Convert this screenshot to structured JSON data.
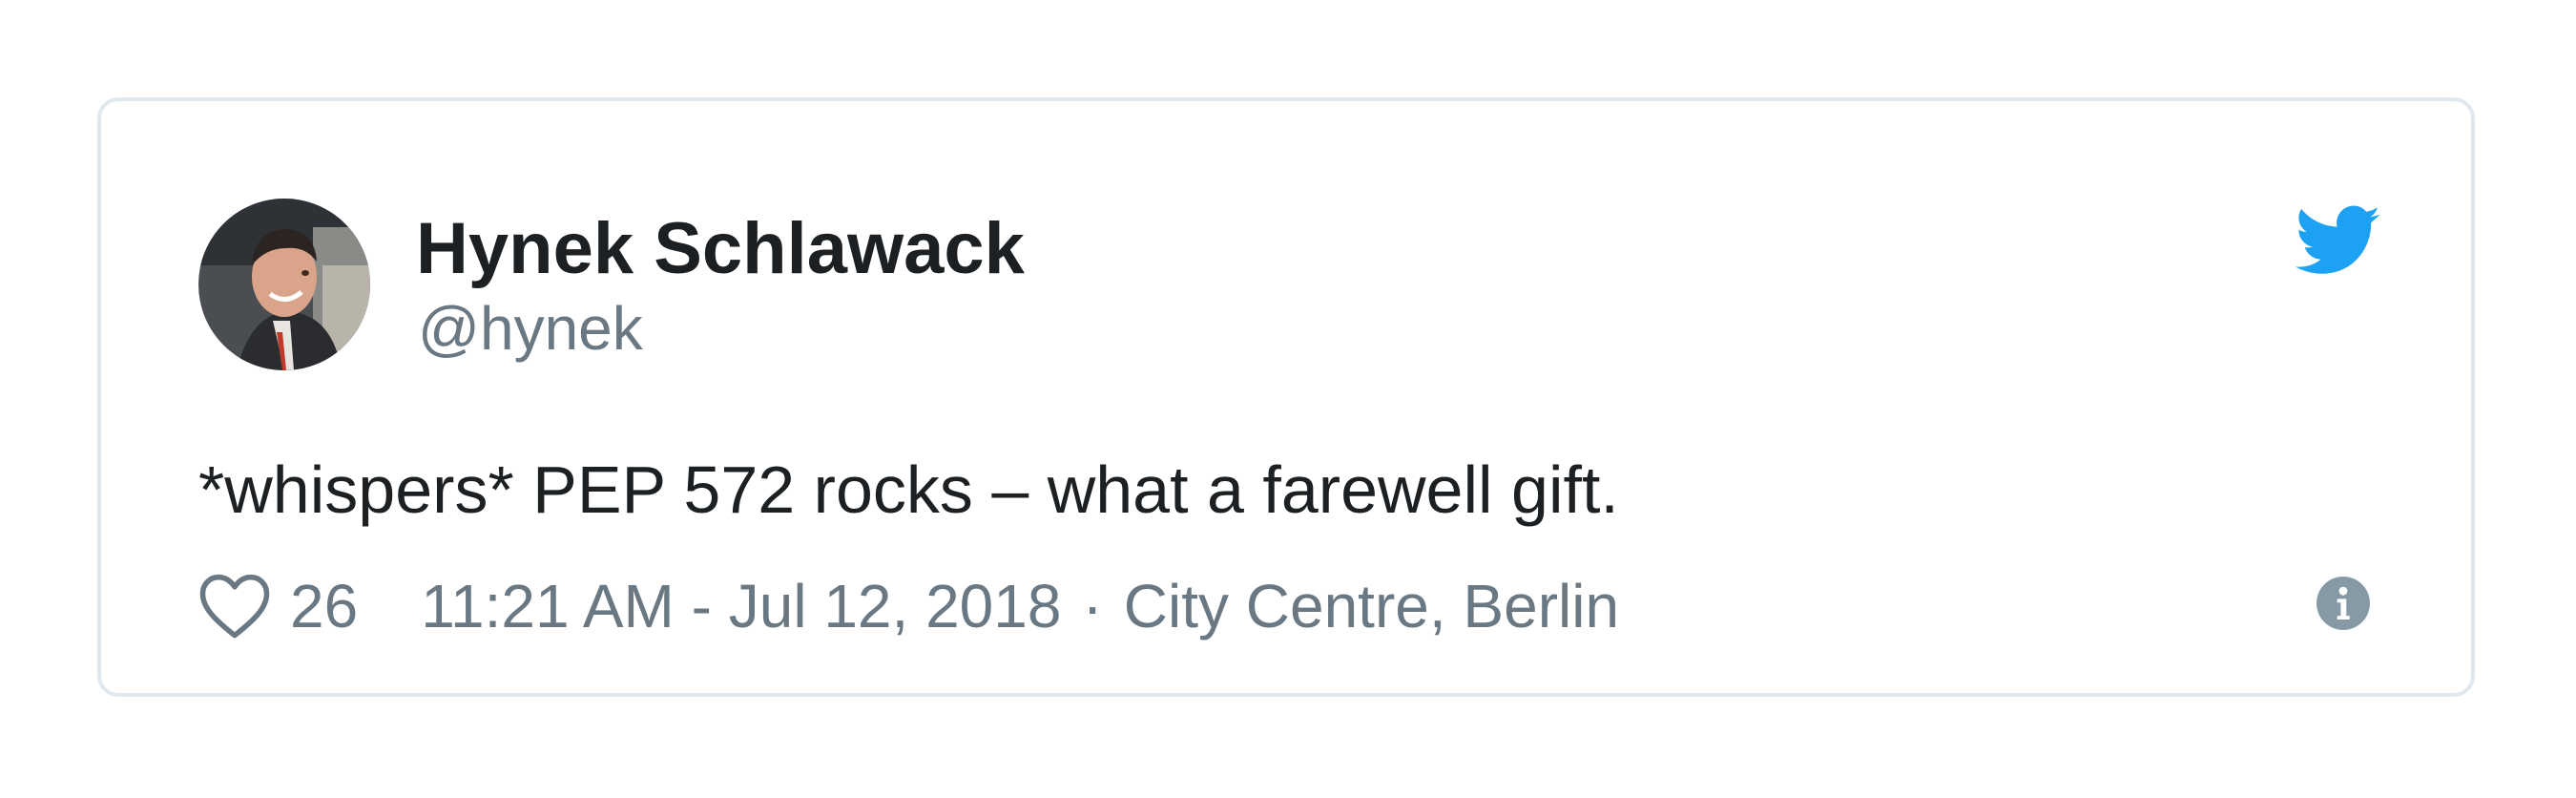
{
  "tweet": {
    "author": {
      "display_name": "Hynek Schlawack",
      "handle": "@hynek"
    },
    "text": "*whispers* PEP 572 rocks – what a farewell gift.",
    "likes": "26",
    "timestamp": "11:21 AM - Jul 12, 2018",
    "separator": "·",
    "location": "City Centre, Berlin"
  },
  "icons": {
    "logo": "twitter-bird-icon",
    "like": "heart-icon",
    "info": "info-icon"
  },
  "colors": {
    "twitter_blue": "#1da1f2",
    "text_primary": "#1c2022",
    "text_secondary": "#697882",
    "border": "#e1e8ed"
  }
}
